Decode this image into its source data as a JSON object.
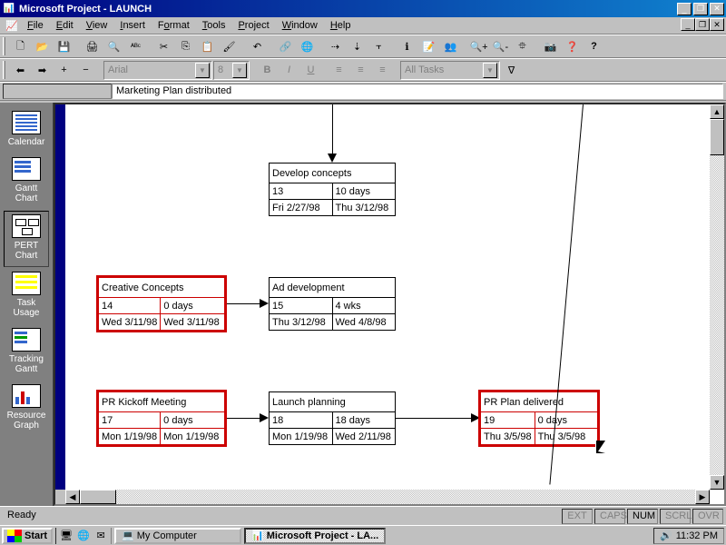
{
  "title": "Microsoft Project - LAUNCH",
  "menus": [
    "File",
    "Edit",
    "View",
    "Insert",
    "Format",
    "Tools",
    "Project",
    "Window",
    "Help"
  ],
  "font_combo": "Arial",
  "size_combo": "8",
  "filter_combo": "All Tasks",
  "entry_value": "Marketing Plan distributed",
  "viewbar": [
    {
      "key": "calendar",
      "label": "Calendar"
    },
    {
      "key": "gantt",
      "label": "Gantt Chart"
    },
    {
      "key": "pert",
      "label": "PERT Chart"
    },
    {
      "key": "usage",
      "label": "Task Usage"
    },
    {
      "key": "tracking",
      "label": "Tracking Gantt"
    },
    {
      "key": "rgraph",
      "label": "Resource Graph"
    }
  ],
  "nodes": {
    "develop": {
      "name": "Develop concepts",
      "id": "13",
      "dur": "10 days",
      "start": "Fri 2/27/98",
      "finish": "Thu 3/12/98",
      "milestone": false
    },
    "creative": {
      "name": "Creative Concepts",
      "id": "14",
      "dur": "0 days",
      "start": "Wed 3/11/98",
      "finish": "Wed 3/11/98",
      "milestone": true
    },
    "addev": {
      "name": "Ad development",
      "id": "15",
      "dur": "4 wks",
      "start": "Thu 3/12/98",
      "finish": "Wed 4/8/98",
      "milestone": false
    },
    "prkick": {
      "name": "PR Kickoff Meeting",
      "id": "17",
      "dur": "0 days",
      "start": "Mon 1/19/98",
      "finish": "Mon 1/19/98",
      "milestone": true
    },
    "launch": {
      "name": "Launch planning",
      "id": "18",
      "dur": "18 days",
      "start": "Mon 1/19/98",
      "finish": "Wed 2/11/98",
      "milestone": false
    },
    "prplan": {
      "name": "PR Plan delivered",
      "id": "19",
      "dur": "0 days",
      "start": "Thu 3/5/98",
      "finish": "Thu 3/5/98",
      "milestone": true
    }
  },
  "status": {
    "ready": "Ready",
    "ext": "EXT",
    "caps": "CAPS",
    "num": "NUM",
    "scrl": "SCRL",
    "ovr": "OVR"
  },
  "taskbar": {
    "start": "Start",
    "tasks": [
      {
        "label": "My Computer",
        "active": false
      },
      {
        "label": "Microsoft Project - LA...",
        "active": true
      }
    ],
    "clock": "11:32 PM"
  }
}
